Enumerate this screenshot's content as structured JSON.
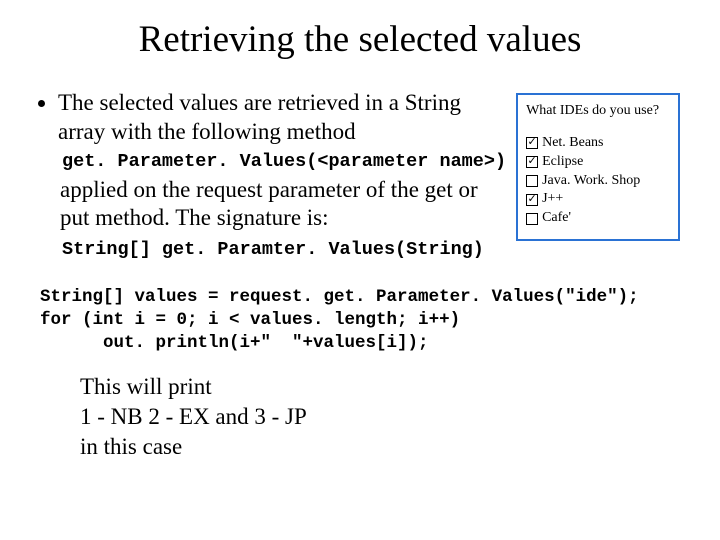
{
  "title": "Retrieving the selected values",
  "bullet1": "The selected values are retrieved in a String array with the following method",
  "code1": "get. Parameter. Values(<parameter name>)",
  "para1": "applied on the request parameter of the get or put method. The signature is:",
  "code2": "String[] get. Paramter. Values(String)",
  "panel": {
    "question": "What IDEs do you use?",
    "opts": [
      {
        "label": "Net. Beans",
        "checked": true
      },
      {
        "label": "Eclipse",
        "checked": true
      },
      {
        "label": "Java. Work. Shop",
        "checked": false
      },
      {
        "label": "J++",
        "checked": true
      },
      {
        "label": "Cafe'",
        "checked": false
      }
    ]
  },
  "codeblock": "String[] values = request. get. Parameter. Values(\"ide\");\nfor (int i = 0; i < values. length; i++)\n      out. println(i+\"  \"+values[i]);",
  "closing_l1": "This will print",
  "closing_l2": "1 - NB 2 - EX and 3 - JP",
  "closing_l3": "in this case"
}
